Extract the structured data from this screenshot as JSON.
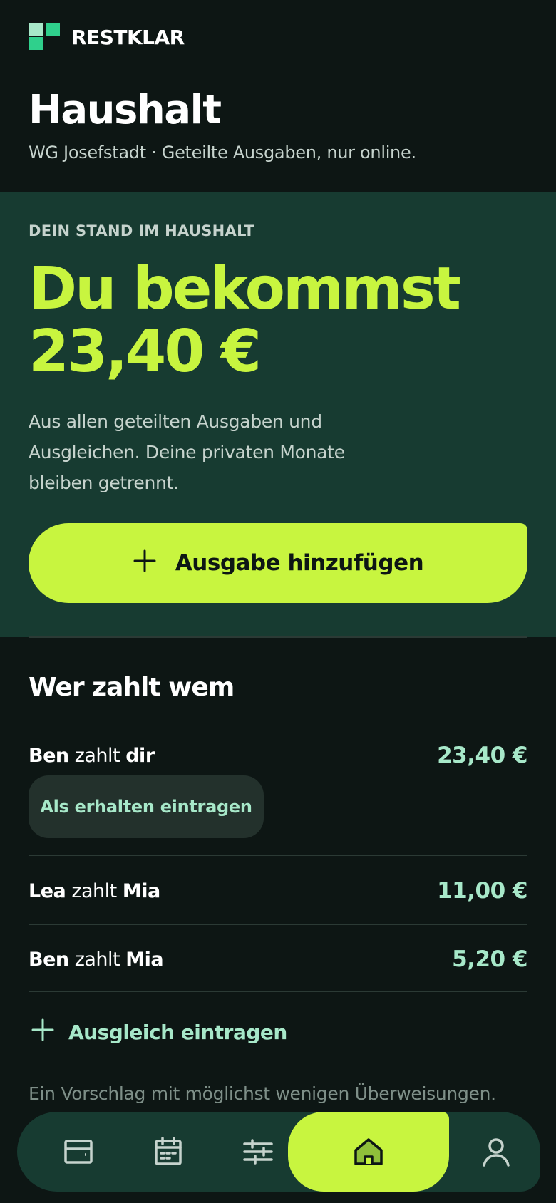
{
  "brand": {
    "name": "RESTKLAR"
  },
  "page": {
    "title": "Haushalt",
    "subtitle": "WG Josefstadt · Geteilte Ausgaben, nur online."
  },
  "hero": {
    "kicker": "DEIN STAND IM HAUSHALT",
    "headline_line1": "Du bekommst",
    "headline_line2": "23,40 €",
    "description": "Aus allen geteilten Ausgaben und Ausgleichen. Deine privaten Monate bleiben getrennt.",
    "add_button_icon": "plus-icon",
    "add_button_label": "Ausgabe hinzufügen"
  },
  "settlements": {
    "title": "Wer zahlt wem",
    "verb": "zahlt",
    "rows": [
      {
        "from": "Ben",
        "to": "dir",
        "amount": "23,40 €"
      },
      {
        "from": "Lea",
        "to": "Mia",
        "amount": "11,00 €"
      },
      {
        "from": "Ben",
        "to": "Mia",
        "amount": "5,20 €"
      }
    ],
    "mark_received_label": "Als erhalten eintragen",
    "add_settlement_label": "Ausgleich eintragen",
    "footnote": "Ein Vorschlag mit möglichst wenigen Überweisungen."
  },
  "nav": {
    "items": [
      {
        "icon": "wallet-icon",
        "active": false
      },
      {
        "icon": "calendar-icon",
        "active": false
      },
      {
        "icon": "sliders-icon",
        "active": false
      },
      {
        "icon": "home-icon",
        "active": true
      },
      {
        "icon": "user-icon",
        "active": false
      }
    ]
  },
  "colors": {
    "background": "#0d1614",
    "hero": "#173b31",
    "accent": "#c8f53f",
    "mint": "#a7e8c9",
    "muted": "#c6d3cd"
  }
}
